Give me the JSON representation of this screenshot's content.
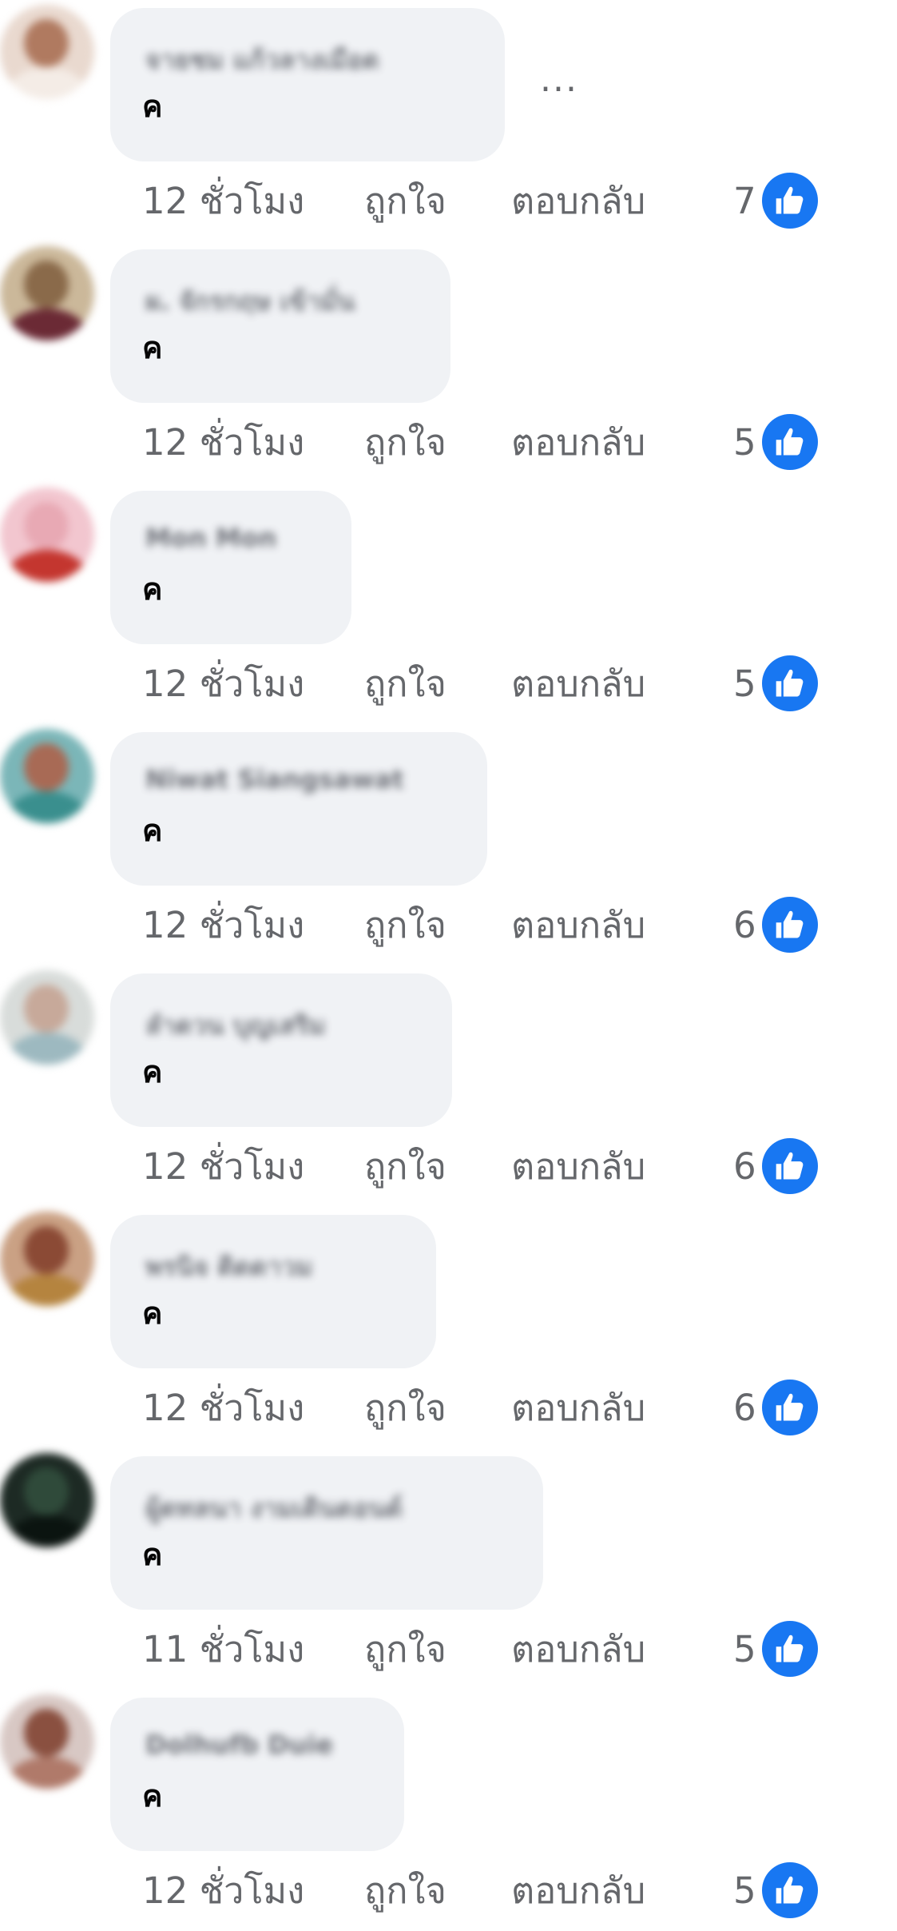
{
  "comments": [
    {
      "author": "จายชม แก้วลางเมือด",
      "text": "ค",
      "time": "12 ชั่วโมง",
      "like_label": "ถูกใจ",
      "reply_label": "ตอบกลับ",
      "reaction_count": "7",
      "more_label": "..."
    },
    {
      "author": "ผ. จักรกฤษ เข้ามั่น",
      "text": "ค",
      "time": "12 ชั่วโมง",
      "like_label": "ถูกใจ",
      "reply_label": "ตอบกลับ",
      "reaction_count": "5"
    },
    {
      "author": "Mon Mon",
      "text": "ค",
      "time": "12 ชั่วโมง",
      "like_label": "ถูกใจ",
      "reply_label": "ตอบกลับ",
      "reaction_count": "5"
    },
    {
      "author": "Niwat Siangsawat",
      "text": "ค",
      "time": "12 ชั่วโมง",
      "like_label": "ถูกใจ",
      "reply_label": "ตอบกลับ",
      "reaction_count": "6"
    },
    {
      "author": "ลำดวน บุญเสริม",
      "text": "ค",
      "time": "12 ชั่วโมง",
      "like_label": "ถูกใจ",
      "reply_label": "ตอบกลับ",
      "reaction_count": "6"
    },
    {
      "author": "พรนิจ ติดดาวม",
      "text": "ค",
      "time": "12 ชั่วโมง",
      "like_label": "ถูกใจ",
      "reply_label": "ตอบกลับ",
      "reaction_count": "6"
    },
    {
      "author": "ผู้ดทลนา งามเดินดอนด์",
      "text": "ค",
      "time": "11 ชั่วโมง",
      "like_label": "ถูกใจ",
      "reply_label": "ตอบกลับ",
      "reaction_count": "5"
    },
    {
      "author": "Dolhufb Duie",
      "text": "ค",
      "time": "12 ชั่วโมง",
      "like_label": "ถูกใจ",
      "reply_label": "ตอบกลับ",
      "reaction_count": "5"
    }
  ],
  "avatar_colors": [
    {
      "bg": "#e9d9cf",
      "face": "#b07a60",
      "body": "#f4ece6"
    },
    {
      "bg": "#cbb89a",
      "face": "#8a6a4a",
      "body": "#6b2a35"
    },
    {
      "bg": "#f2c6cf",
      "face": "#e8a9b4",
      "body": "#c4362f"
    },
    {
      "bg": "#7bb6b8",
      "face": "#a86a55",
      "body": "#3a8f8e"
    },
    {
      "bg": "#d8dcda",
      "face": "#c7a99a",
      "body": "#9db9c0"
    },
    {
      "bg": "#caa184",
      "face": "#8b4a35",
      "body": "#b5843f"
    },
    {
      "bg": "#1d2a24",
      "face": "#2f4a3a",
      "body": "#0b1410"
    },
    {
      "bg": "#d8c8c4",
      "face": "#8a5040",
      "body": "#b07a6a"
    }
  ],
  "colors": {
    "bubble": "#f0f2f5",
    "meta_text": "#65676b",
    "like_blue": "#1877f2"
  }
}
